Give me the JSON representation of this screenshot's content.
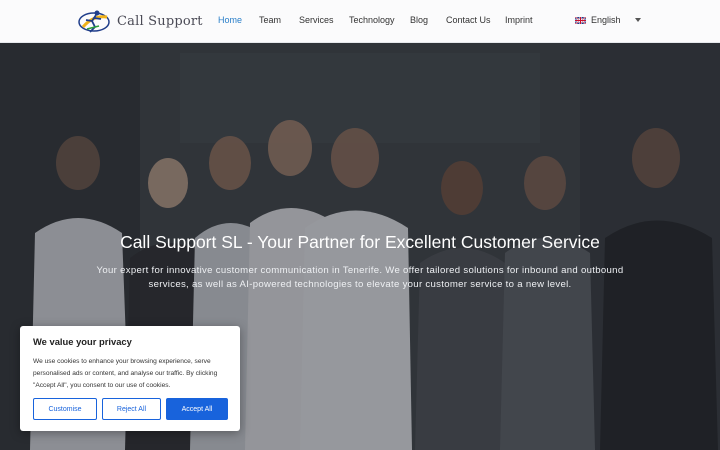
{
  "header": {
    "logo_text": "Call Support",
    "nav": [
      {
        "label": "Home",
        "active": true
      },
      {
        "label": "Team",
        "active": false
      },
      {
        "label": "Services",
        "active": false
      },
      {
        "label": "Technology",
        "active": false
      },
      {
        "label": "Blog",
        "active": false
      },
      {
        "label": "Contact Us",
        "active": false
      },
      {
        "label": "Imprint",
        "active": false
      }
    ],
    "language": "English"
  },
  "hero": {
    "title": "Call Support SL - Your Partner for Excellent Customer Service",
    "subtitle": "Your expert for innovative customer communication in Tenerife. We offer tailored solutions for inbound and outbound services, as well as AI-powered technologies to elevate your customer service to a new level."
  },
  "cookie_banner": {
    "title": "We value your privacy",
    "text": "We use cookies to enhance your browsing experience, serve personalised ads or content, and analyse our traffic. By clicking \"Accept All\", you consent to our use of cookies.",
    "customise_label": "Customise",
    "reject_label": "Reject All",
    "accept_label": "Accept All"
  },
  "colors": {
    "accent": "#2a7fc9",
    "button_blue": "#1863dc"
  }
}
